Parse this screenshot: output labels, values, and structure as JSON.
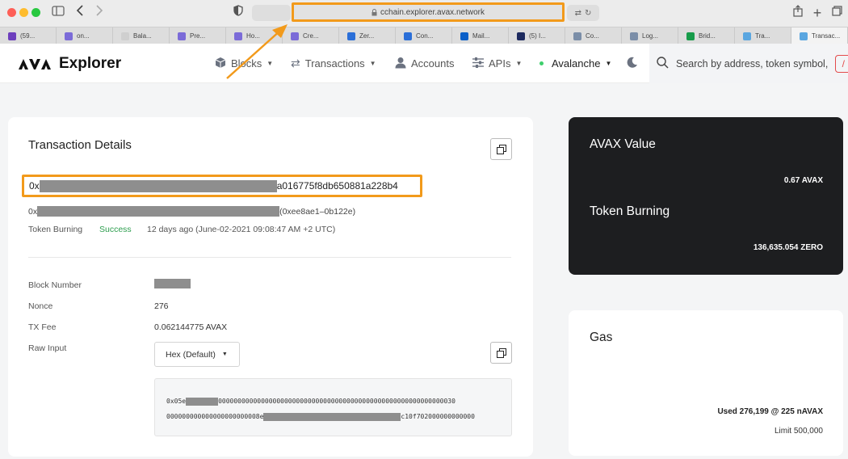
{
  "browser": {
    "url": "cchain.explorer.avax.network",
    "tabs": [
      {
        "label": "(59...",
        "color": "#6d3fbd"
      },
      {
        "label": "on...",
        "color": "#7b6bd8"
      },
      {
        "label": "Bala...",
        "color": "#cfcfcf"
      },
      {
        "label": "Pre...",
        "color": "#7b6bd8"
      },
      {
        "label": "Ho...",
        "color": "#7b6bd8"
      },
      {
        "label": "Cre...",
        "color": "#7b6bd8"
      },
      {
        "label": "Zer...",
        "color": "#2b6fd8"
      },
      {
        "label": "Con...",
        "color": "#2b6fd8"
      },
      {
        "label": "Mail...",
        "color": "#0a5fc8"
      },
      {
        "label": "(5) I...",
        "color": "#1d2a5f"
      },
      {
        "label": "Co...",
        "color": "#7b8ea8"
      },
      {
        "label": "Log...",
        "color": "#7b8ea8"
      },
      {
        "label": "Brid...",
        "color": "#179c4a"
      },
      {
        "label": "Tra...",
        "color": "#5aa6e0"
      },
      {
        "label": "Transac...",
        "color": "#5aa6e0"
      }
    ]
  },
  "header": {
    "logo_mark": "AVA",
    "logo_text": "Explorer",
    "nav": {
      "blocks": "Blocks",
      "transactions": "Transactions",
      "accounts": "Accounts",
      "apis": "APIs",
      "network": "Avalanche"
    },
    "search_placeholder": "Search by address, token symbol,",
    "search_shortcut": "/"
  },
  "tx": {
    "title": "Transaction Details",
    "hash_prefix": "0x",
    "hash_suffix": "a016775f8db650881a228b4",
    "from_prefix": "0x",
    "from_suffix": "(0xee8ae1–0b122e)",
    "type": "Token Burning",
    "status": "Success",
    "time": "12 days ago (June-02-2021 09:08:47 AM +2 UTC)",
    "fields": {
      "block_number_label": "Block Number",
      "nonce_label": "Nonce",
      "nonce": "276",
      "fee_label": "TX Fee",
      "fee": "0.062144775 AVAX",
      "raw_input_label": "Raw Input",
      "raw_format": "Hex (Default)"
    },
    "raw_line1_prefix": "0x05e",
    "raw_line1_suffix": "0000000000000000000000000000000000000000000000000000000000030",
    "raw_line2_prefix": "000000000000000000000008e",
    "raw_line2_suffix": "c10f702000000000000"
  },
  "avax_card": {
    "title": "AVAX Value",
    "avax_value": "0.67 AVAX",
    "burn_title": "Token Burning",
    "burn_value": "136,635.054 ZERO"
  },
  "gas_card": {
    "title": "Gas",
    "used": "Used 276,199 @ 225 nAVAX",
    "limit": "Limit 500,000"
  },
  "colors": {
    "success": "#2e9e4f",
    "highlight": "#f29a1b",
    "dark_card": "#1d1e20"
  }
}
